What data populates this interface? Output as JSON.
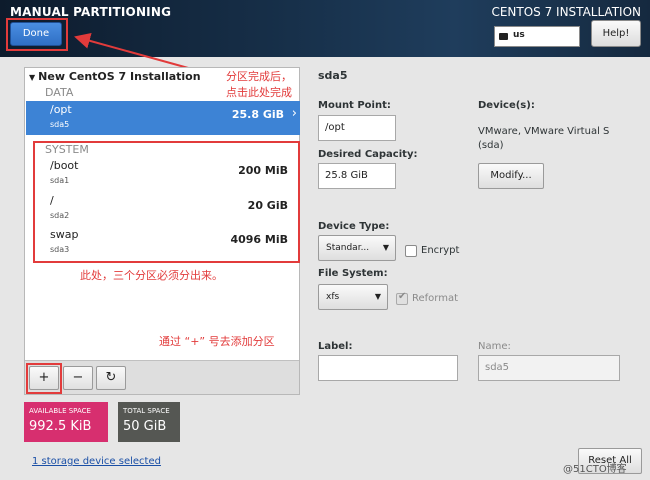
{
  "header": {
    "title": "MANUAL PARTITIONING",
    "installer_title": "CENTOS 7 INSTALLATION",
    "done_label": "Done",
    "keyboard_layout": "us",
    "help_label": "Help!"
  },
  "tree": {
    "title": "New CentOS 7 Installation",
    "data_group": "DATA",
    "system_group": "SYSTEM",
    "data_partitions": [
      {
        "name": "/opt",
        "device": "sda5",
        "size": "25.8 GiB",
        "selected": true
      }
    ],
    "system_partitions": [
      {
        "name": "/boot",
        "device": "sda1",
        "size": "200 MiB"
      },
      {
        "name": "/",
        "device": "sda2",
        "size": "20 GiB"
      },
      {
        "name": "swap",
        "device": "sda3",
        "size": "4096 MiB"
      }
    ]
  },
  "toolbar": {
    "add_label": "+",
    "remove_label": "−",
    "refresh_label": "↻"
  },
  "space": {
    "available_label": "AVAILABLE SPACE",
    "available_value": "992.5 KiB",
    "total_label": "TOTAL SPACE",
    "total_value": "50 GiB"
  },
  "storage_link": "1 storage device selected",
  "annotations": {
    "done_note_line1": "分区完成后，",
    "done_note_line2": "点击此处完成",
    "system_note": "此处，三个分区必须分出来。",
    "add_note": "通过 “+” 号去添加分区"
  },
  "detail": {
    "title": "sda5",
    "mount_point_label": "Mount Point:",
    "mount_point_value": "/opt",
    "desired_capacity_label": "Desired Capacity:",
    "desired_capacity_value": "25.8 GiB",
    "devices_label": "Device(s):",
    "devices_line1": "VMware, VMware Virtual S",
    "devices_line2": "(sda)",
    "modify_label": "Modify...",
    "device_type_label": "Device Type:",
    "device_type_value": "Standar...",
    "encrypt_label": "Encrypt",
    "file_system_label": "File System:",
    "file_system_value": "xfs",
    "reformat_label": "Reformat",
    "label_label": "Label:",
    "label_value": "",
    "name_label": "Name:",
    "name_value": "sda5",
    "reset_label": "Reset All"
  },
  "watermark": "@51CTO博客",
  "colors": {
    "accent": "#3d83d5",
    "available_space": "#d72f6f",
    "total_space": "#555753",
    "annotation": "#e23b3b"
  }
}
